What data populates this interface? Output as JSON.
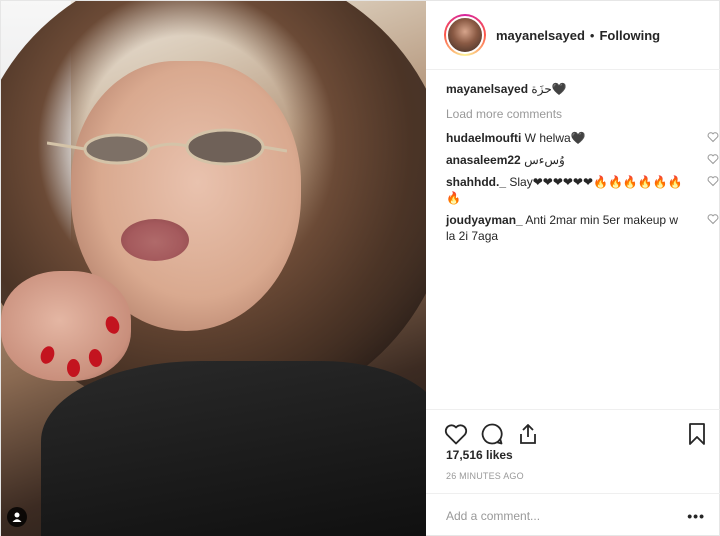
{
  "post": {
    "author": "mayanelsayed",
    "follow_separator": "•",
    "follow_status": "Following",
    "caption": {
      "username": "mayanelsayed",
      "text": "حزَة🖤"
    },
    "load_more_label": "Load more comments",
    "comments": [
      {
        "username": "hudaelmoufti",
        "text": "W helwa🖤"
      },
      {
        "username": "anasaleem22",
        "text": "وُسءس"
      },
      {
        "username": "shahhdd._",
        "text": "Slay❤❤❤❤❤❤🔥🔥🔥🔥🔥🔥🔥"
      },
      {
        "username": "joudyayman_",
        "text": "Anti 2mar min 5er makeup w la 2i 7aga"
      }
    ],
    "likes": "17,516 likes",
    "timestamp": "26 MINUTES AGO",
    "add_comment_placeholder": "Add a comment...",
    "more_options": "•••"
  },
  "icons": {
    "like": "heart-icon",
    "comment": "comment-icon",
    "share": "share-icon",
    "save": "bookmark-icon",
    "tag": "person-tag-icon",
    "comment_like": "small-heart-icon"
  },
  "colors": {
    "text": "#262626",
    "muted": "#999999",
    "border": "#efefef",
    "nail": "#c3141f"
  }
}
